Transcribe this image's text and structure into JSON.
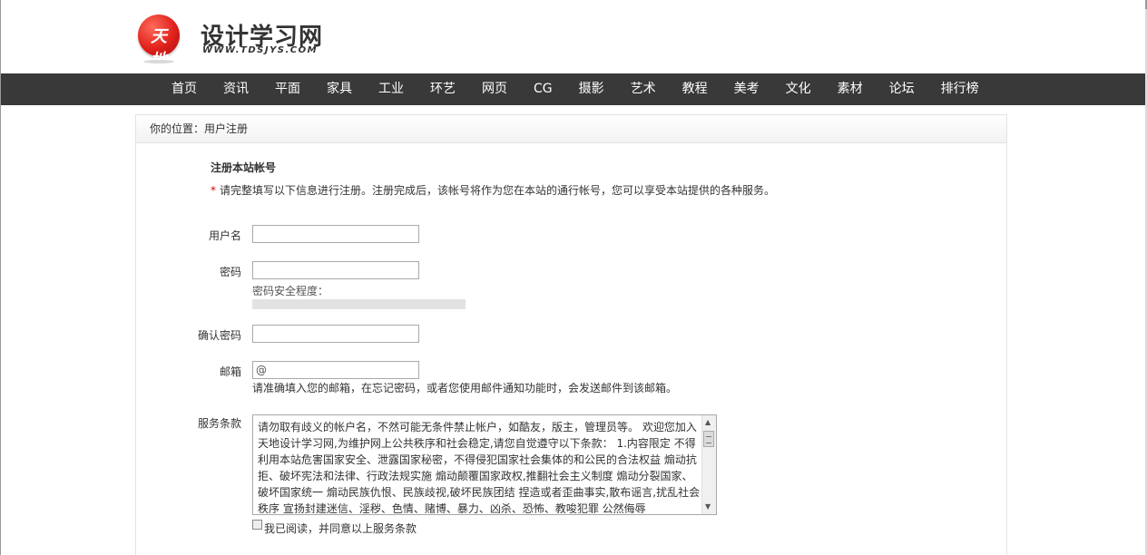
{
  "header": {
    "logo_glyph": "天地",
    "site_name": "设计学习网",
    "site_url": "WWW.TDSJYS.COM"
  },
  "nav": {
    "items": [
      "首页",
      "资讯",
      "平面",
      "家具",
      "工业",
      "环艺",
      "网页",
      "CG",
      "摄影",
      "艺术",
      "教程",
      "美考",
      "文化",
      "素材",
      "论坛",
      "排行榜"
    ]
  },
  "breadcrumb": "你的位置：用户注册",
  "form": {
    "title": "注册本站帐号",
    "note_star": "*",
    "note": "请完整填写以下信息进行注册。注册完成后，该帐号将作为您在本站的通行帐号，您可以享受本站提供的各种服务。",
    "username_label": "用户名",
    "password_label": "密码",
    "password_strength_label": "密码安全程度：",
    "confirm_label": "确认密码",
    "email_label": "邮箱",
    "email_placeholder": "@",
    "email_hint": "请准确填入您的邮箱，在忘记密码，或者您使用邮件通知功能时，会发送邮件到该邮箱。",
    "terms_label": "服务条款",
    "terms_text": "请勿取有歧义的帐户名，不然可能无条件禁止帐户，如酷友，版主，管理员等。 欢迎您加入天地设计学习网,为维护网上公共秩序和社会稳定,请您自觉遵守以下条款： 1.内容限定 不得利用本站危害国家安全、泄露国家秘密，不得侵犯国家社会集体的和公民的合法权益 煽动抗拒、破坏宪法和法律、行政法规实施 煽动颠覆国家政权,推翻社会主义制度 煽动分裂国家、破坏国家统一 煽动民族仇恨、民族歧视,破坏民族团结 捏造或者歪曲事实,散布谣言,扰乱社会秩序 宣扬封建迷信、淫秽、色情、赌博、暴力、凶杀、恐怖、教唆犯罪 公然侮辱",
    "agree_label": "我已阅读，并同意以上服务条款"
  }
}
